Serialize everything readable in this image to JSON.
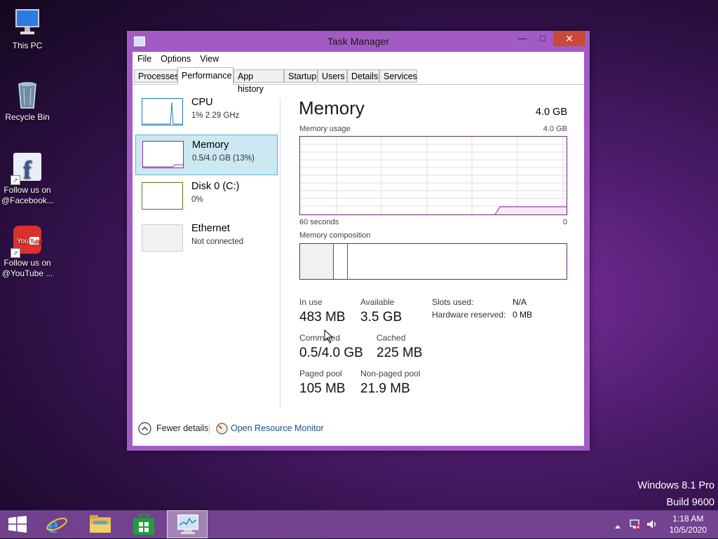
{
  "desktop": {
    "icons": [
      {
        "label": "This PC"
      },
      {
        "label": "Recycle Bin"
      },
      {
        "label_line1": "Follow us on",
        "label_line2": "@Facebook..."
      },
      {
        "label_line1": "Follow us on",
        "label_line2": "@YouTube ..."
      }
    ],
    "watermark": {
      "line1": "Windows 8.1 Pro",
      "line2": "Build 9600"
    }
  },
  "window": {
    "title": "Task Manager",
    "buttons": {
      "minimize": "—",
      "maximize": "□",
      "close": "✕"
    },
    "menu": [
      "File",
      "Options",
      "View"
    ],
    "tabs": [
      "Processes",
      "Performance",
      "App history",
      "Startup",
      "Users",
      "Details",
      "Services"
    ],
    "active_tab": "Performance"
  },
  "perf_list": [
    {
      "name": "CPU",
      "sub": "1% 2.29 GHz",
      "color": "#1a7cbf"
    },
    {
      "name": "Memory",
      "sub": "0.5/4.0 GB (13%)",
      "color": "#8b2c9a"
    },
    {
      "name": "Disk 0 (C:)",
      "sub": "0%",
      "color": "#4f7a14"
    },
    {
      "name": "Ethernet",
      "sub": "Not connected",
      "color": "#bbbbbb"
    }
  ],
  "detail": {
    "title": "Memory",
    "total": "4.0 GB",
    "usage_label": "Memory usage",
    "usage_max": "4.0 GB",
    "axis_left": "60 seconds",
    "axis_right": "0",
    "composition_label": "Memory composition",
    "stats": [
      {
        "label": "In use",
        "value": "483 MB"
      },
      {
        "label": "Available",
        "value": "3.5 GB"
      },
      {
        "label": "Committed",
        "value": "0.5/4.0 GB"
      },
      {
        "label": "Cached",
        "value": "225 MB"
      },
      {
        "label": "Paged pool",
        "value": "105 MB"
      },
      {
        "label": "Non-paged pool",
        "value": "21.9 MB"
      }
    ],
    "kv": [
      {
        "label": "Slots used:",
        "value": "N/A"
      },
      {
        "label": "Hardware reserved:",
        "value": "0 MB"
      }
    ]
  },
  "footer": {
    "fewer_details": "Fewer details",
    "resource_monitor": "Open Resource Monitor"
  },
  "taskbar": {
    "time": "1:18 AM",
    "date": "10/5/2020"
  }
}
